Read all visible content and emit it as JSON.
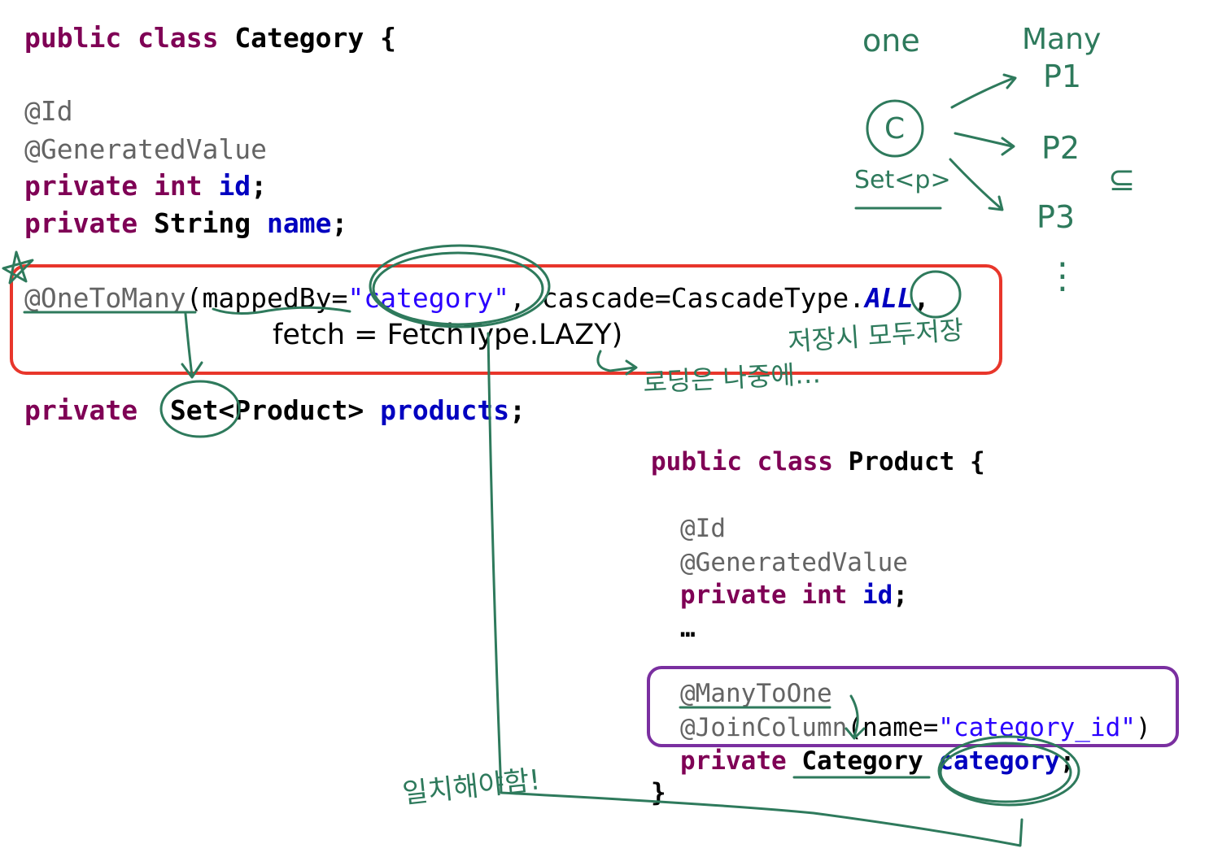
{
  "category": {
    "kw_public": "public",
    "kw_class": "class",
    "class_name": "Category",
    "open_brace": "{",
    "ann_id": "@Id",
    "ann_generated": "@GeneratedValue",
    "kw_private": "private",
    "type_int": "int",
    "field_id": "id",
    "type_string": "String",
    "field_name": "name",
    "semicolon": ";",
    "ann_onetomany": "@OneToMany",
    "paren_mappedby": "(mappedBy=",
    "mappedby_value": "\"category\"",
    "cascade_part": ", cascade=CascadeType.",
    "cascade_all": "ALL",
    "comma": ",",
    "fetch_line": "fetch = FetchType.LAZY)",
    "set_type": "Set<Product>",
    "field_products": "products"
  },
  "product": {
    "kw_public": "public",
    "kw_class": "class",
    "class_name": "Product",
    "open_brace": "{",
    "ann_id": "@Id",
    "ann_generated": "@GeneratedValue",
    "kw_private": "private",
    "type_int": "int",
    "field_id": "id",
    "ellipsis": "…",
    "ann_manytoone": "@ManyToOne",
    "ann_joincolumn": "@JoinColumn",
    "join_open": "(name=",
    "join_value": "\"category_id\"",
    "join_close": ")",
    "type_category": "Category",
    "field_category": "category",
    "semicolon": ";",
    "close_brace": "}"
  },
  "handwriting": {
    "one": "one",
    "many": "Many",
    "c": "C",
    "set_p": "Set<p>",
    "p1": "P1",
    "p2": "P2",
    "p3": "P3",
    "subset": "⊆",
    "dots": "⋮",
    "save_note": "저장시 모두저장",
    "loading_note": "로딩은 나중에…",
    "match_note": "일치해야함!",
    "star": "☆"
  },
  "colors": {
    "keyword": "#7f0055",
    "field": "#0000c0",
    "annotation": "#646464",
    "string": "#2a00ff",
    "ink": "#2e7a5c",
    "red_box": "#e8362b",
    "purple_box": "#7a2fa0"
  }
}
